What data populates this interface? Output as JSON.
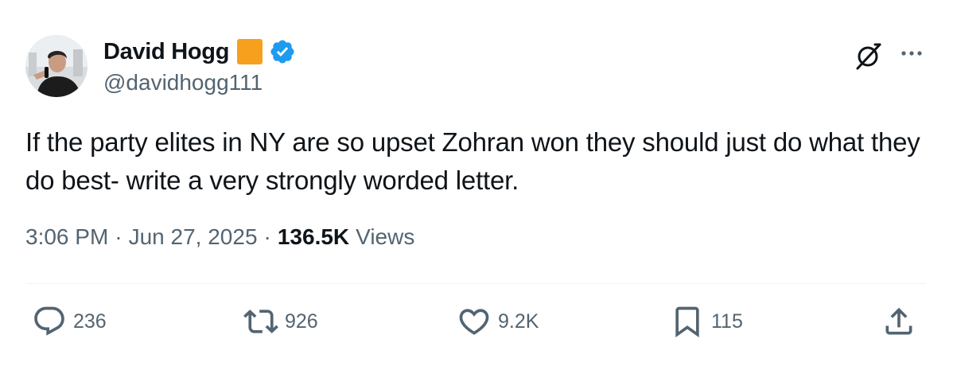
{
  "author": {
    "display_name": "David Hogg",
    "handle": "@davidhogg111"
  },
  "tweet": {
    "text": "If the party elites in NY are so upset Zohran won they should just do what they do best- write a very strongly worded letter."
  },
  "meta": {
    "time": "3:06 PM",
    "date": "Jun 27, 2025",
    "separator": "·",
    "views_count": "136.5K",
    "views_label": "Views"
  },
  "actions": {
    "replies": "236",
    "reposts": "926",
    "likes": "9.2K",
    "bookmarks": "115"
  },
  "icons": {
    "grok": "grok-icon",
    "more": "more-icon",
    "reply": "reply-icon",
    "repost": "repost-icon",
    "like": "heart-icon",
    "bookmark": "bookmark-icon",
    "share": "share-icon",
    "verified": "verified-badge-icon"
  },
  "colors": {
    "verified_blue": "#1d9bf0",
    "affiliate_badge": "#f7a01e",
    "secondary_text": "#536471",
    "primary_text": "#0f1419"
  }
}
